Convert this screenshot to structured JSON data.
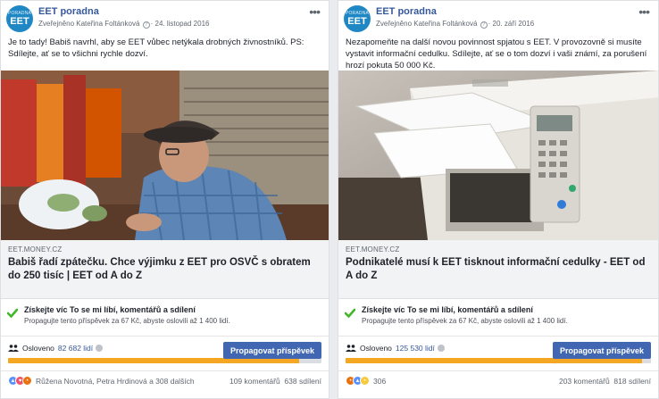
{
  "posts": [
    {
      "page_name": "EET poradna",
      "avatar": {
        "sub": "PORADNA",
        "main": "EET",
        "color": "#1f88c4"
      },
      "publisher": "Zveřejněno Kateřina Foltánková",
      "date": "24. listopad 2016",
      "text": "Je to tady! Babiš navrhl, aby se EET vůbec netýkala drobných živnostníků. PS: Sdílejte, ať se to všichni rychle dozví.",
      "image_icon": "old-man-sewing-photo",
      "link_domain": "EET.MONEY.CZ",
      "link_title": "Babiš řadí zpátečku. Chce výjimku z EET pro OSVČ s obratem do 250 tisíc | EET od A do Z",
      "promo_title": "Získejte víc To se mi líbí, komentářů a sdílení",
      "promo_sub": "Propagujte tento příspěvek za 67 Kč, abyste oslovili až 1 400 lidí.",
      "reach_label": "Osloveno",
      "reach_value": "82 682 lidí",
      "reach_fraction": 0.93,
      "boost_label": "Propagovat příspěvek",
      "reactions_text": "Růžena Novotná, Petra Hrdinová a 308 dalších",
      "comments": "109 komentářů",
      "shares": "638 sdílení"
    },
    {
      "page_name": "EET poradna",
      "avatar": {
        "sub": "PORADNA",
        "main": "EET",
        "color": "#1f88c4"
      },
      "publisher": "Zveřejněno Kateřina Foltánková",
      "date": "20. září 2016",
      "text": "Nezapomeňte na další novou povinnost spjatou s EET. V provozovně si musíte vystavit informační cedulku. Sdílejte, ať se o tom dozví i vaši známí, za porušení hrozí pokuta 50 000 Kč.",
      "image_icon": "office-printer-photo",
      "link_domain": "EET.MONEY.CZ",
      "link_title": "Podnikatelé musí k EET tisknout informační cedulky - EET od A do Z",
      "promo_title": "Získejte víc To se mi líbí, komentářů a sdílení",
      "promo_sub": "Propagujte tento příspěvek za 67 Kč, abyste oslovili až 1 400 lidí.",
      "reach_label": "Osloveno",
      "reach_value": "125 530 lidí",
      "reach_fraction": 0.97,
      "boost_label": "Propagovat příspěvek",
      "reactions_text": "306",
      "comments": "203 komentářů",
      "shares": "818 sdílení"
    }
  ],
  "colors": {
    "link_blue": "#365899",
    "boost_blue": "#4267b2",
    "reach_orange": "#f5a623",
    "check_green": "#42b72a"
  }
}
